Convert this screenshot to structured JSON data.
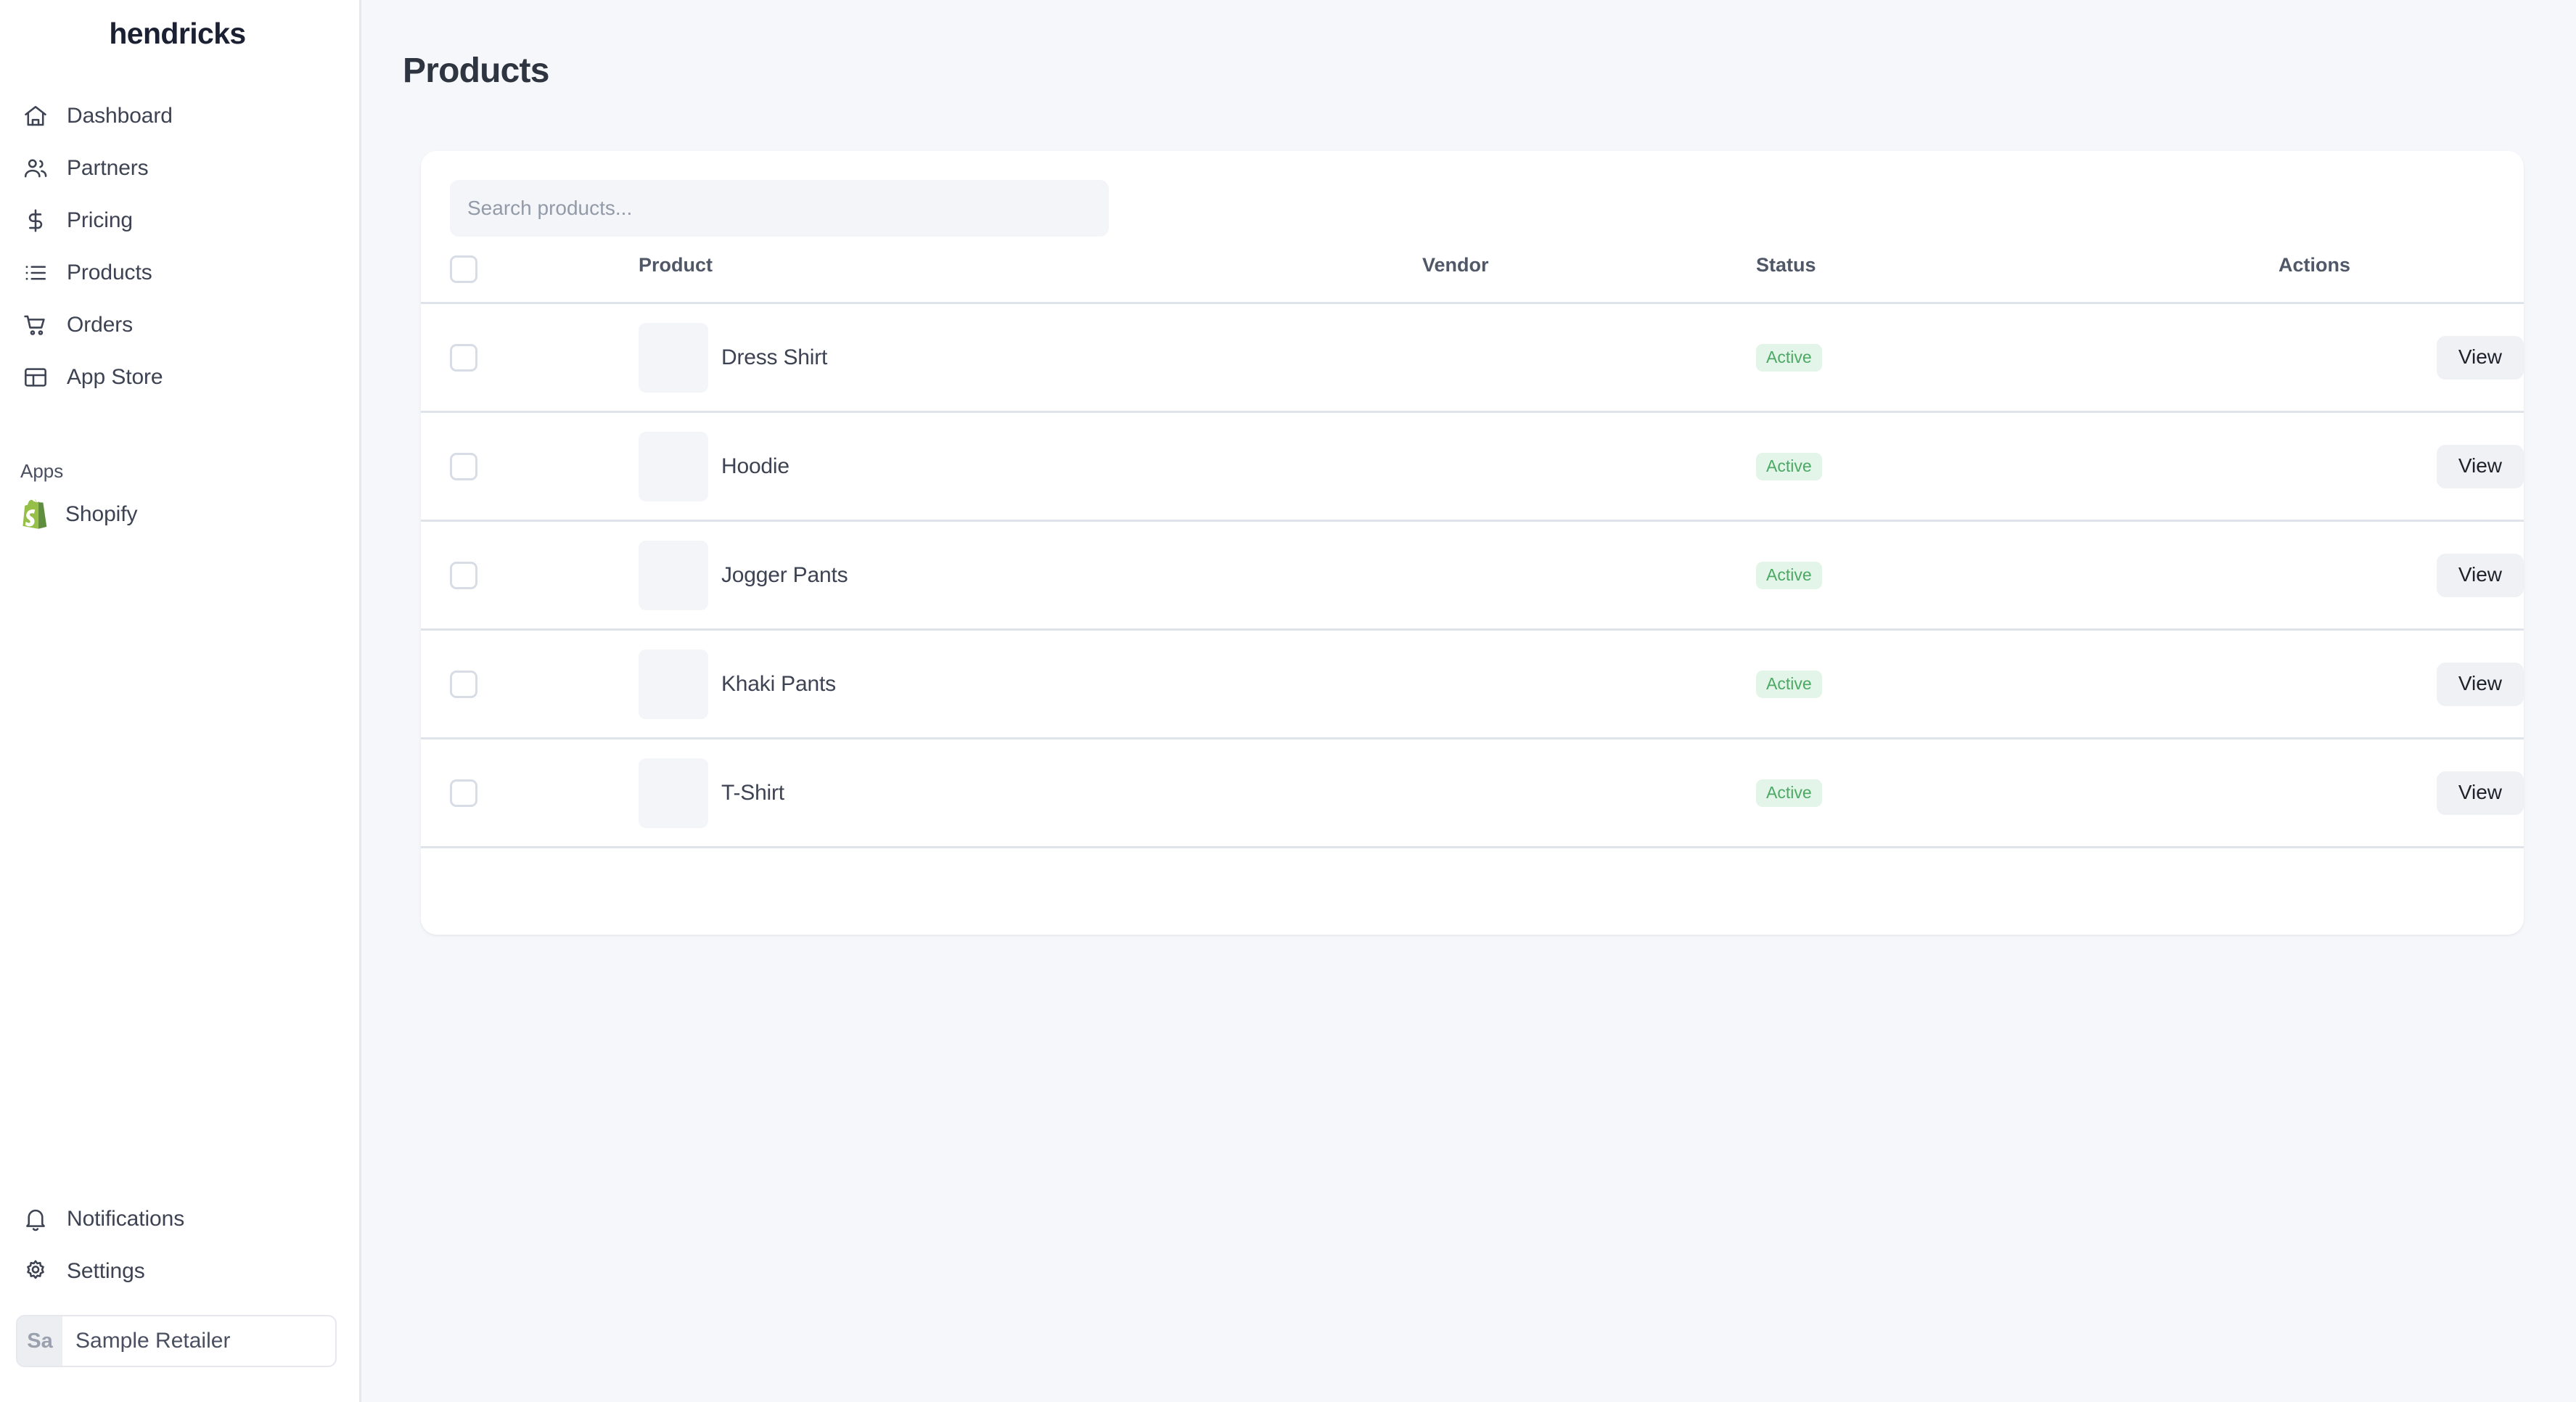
{
  "sidebar": {
    "brand": "hendricks",
    "nav_items": [
      {
        "label": "Dashboard",
        "icon": "home-icon"
      },
      {
        "label": "Partners",
        "icon": "users-icon"
      },
      {
        "label": "Pricing",
        "icon": "dollar-icon"
      },
      {
        "label": "Products",
        "icon": "list-icon"
      },
      {
        "label": "Orders",
        "icon": "cart-icon"
      },
      {
        "label": "App Store",
        "icon": "layout-icon"
      }
    ],
    "apps_section_label": "Apps",
    "apps": [
      {
        "label": "Shopify",
        "icon": "shopify-icon"
      }
    ],
    "footer_items": [
      {
        "label": "Notifications",
        "icon": "bell-icon"
      },
      {
        "label": "Settings",
        "icon": "gear-icon"
      }
    ],
    "retailer": {
      "avatar_initials": "Sa",
      "name": "Sample Retailer"
    }
  },
  "main": {
    "page_title": "Products",
    "search": {
      "placeholder": "Search products...",
      "value": ""
    },
    "table": {
      "columns": [
        "",
        "Product",
        "Vendor",
        "Status",
        "Actions"
      ],
      "rows": [
        {
          "product": "Dress Shirt",
          "vendor": "",
          "status": "Active",
          "action_label": "View"
        },
        {
          "product": "Hoodie",
          "vendor": "",
          "status": "Active",
          "action_label": "View"
        },
        {
          "product": "Jogger Pants",
          "vendor": "",
          "status": "Active",
          "action_label": "View"
        },
        {
          "product": "Khaki Pants",
          "vendor": "",
          "status": "Active",
          "action_label": "View"
        },
        {
          "product": "T-Shirt",
          "vendor": "",
          "status": "Active",
          "action_label": "View"
        }
      ]
    }
  },
  "colors": {
    "page_background": "#f6f7fa",
    "card_background": "#ffffff",
    "sidebar_background": "#ffffff",
    "brand_text": "#1c2033",
    "status_active_text": "#4ca865",
    "status_active_bg": "#e3f5e8",
    "divider": "#dfe3ea"
  }
}
